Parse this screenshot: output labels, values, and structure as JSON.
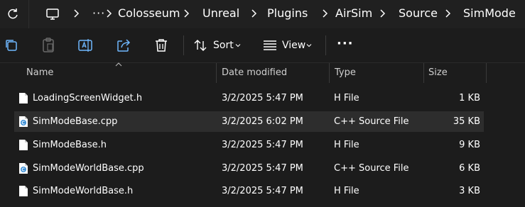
{
  "breadcrumb": [
    "Colosseum",
    "Unreal",
    "Plugins",
    "AirSim",
    "Source",
    "SimMode"
  ],
  "overflow_label": "···",
  "toolbar": {
    "sort_label": "Sort",
    "view_label": "View",
    "more_label": "···"
  },
  "columns": {
    "name": "Name",
    "date": "Date modified",
    "type": "Type",
    "size": "Size"
  },
  "files": [
    {
      "name": "LoadingScreenWidget.h",
      "date": "3/2/2025 5:47 PM",
      "type": "H File",
      "size": "1 KB",
      "icon": "h-file-icon"
    },
    {
      "name": "SimModeBase.cpp",
      "date": "3/2/2025 6:02 PM",
      "type": "C++ Source File",
      "size": "35 KB",
      "icon": "cpp-file-icon",
      "selected": true
    },
    {
      "name": "SimModeBase.h",
      "date": "3/2/2025 5:47 PM",
      "type": "H File",
      "size": "9 KB",
      "icon": "h-file-icon"
    },
    {
      "name": "SimModeWorldBase.cpp",
      "date": "3/2/2025 5:47 PM",
      "type": "C++ Source File",
      "size": "6 KB",
      "icon": "cpp-file-icon"
    },
    {
      "name": "SimModeWorldBase.h",
      "date": "3/2/2025 5:47 PM",
      "type": "H File",
      "size": "3 KB",
      "icon": "h-file-icon"
    }
  ],
  "colors": {
    "background": "#1c1c1c",
    "addressbar": "#202020",
    "selected_row": "#2d2d2d",
    "cpp_icon_accent": "#3b8fd6"
  }
}
